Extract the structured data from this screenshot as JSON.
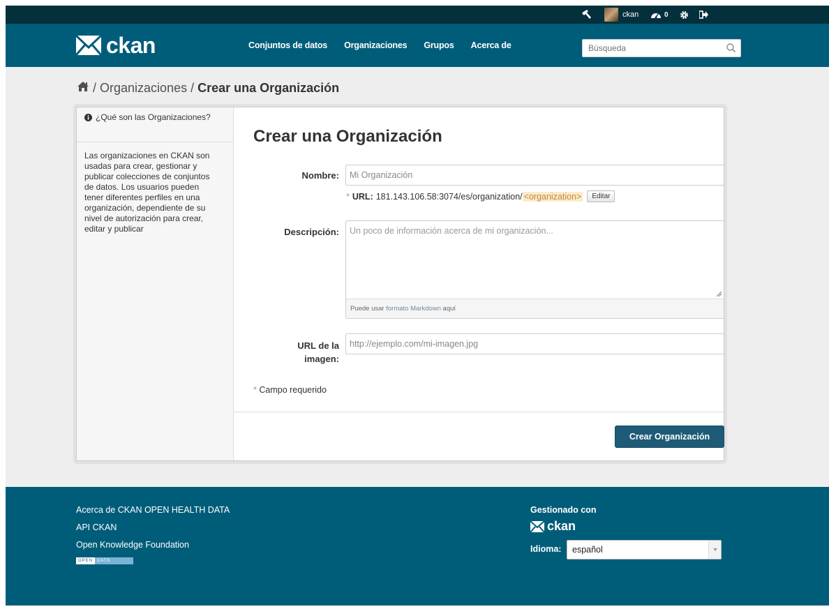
{
  "account": {
    "username": "ckan",
    "activity_count": "0"
  },
  "brand": {
    "logo_text": "ckan"
  },
  "nav": [
    {
      "label": "Conjuntos de datos"
    },
    {
      "label": "Organizaciones"
    },
    {
      "label": "Grupos"
    },
    {
      "label": "Acerca de"
    }
  ],
  "search": {
    "placeholder": "Búsqueda"
  },
  "breadcrumb": {
    "separator": "/",
    "items": [
      {
        "label": "Organizaciones"
      },
      {
        "label": "Crear una Organización"
      }
    ]
  },
  "sidebar": {
    "title": "¿Qué son las Organizaciones?",
    "body": "Las organizaciones en CKAN son usadas para crear, gestionar y publicar colecciones de conjuntos de datos. Los usuarios pueden tener diferentes perfiles en una organización, dependiente de su nivel de autorización para crear, editar y publicar"
  },
  "form": {
    "title": "Crear una Organización",
    "name_label": "Nombre:",
    "name_placeholder": "Mi Organización",
    "required_mark": "*",
    "url_label": "URL:",
    "url_prefix": "181.143.106.58:3074/es/organization/",
    "url_slug": "<organization>",
    "edit_label": "Editar",
    "description_label": "Descripción:",
    "description_placeholder": "Un poco de información acerca de mi organización...",
    "markdown_help_prefix": "Puede usar",
    "markdown_help_link": "formato Markdown",
    "markdown_help_suffix": "aquí",
    "image_label_line1": "URL de la",
    "image_label_line2": "imagen:",
    "image_placeholder": "http://ejemplo.com/mi-imagen.jpg",
    "required_note": "Campo requerido",
    "submit_label": "Crear Organización"
  },
  "footer": {
    "links": [
      {
        "label": "Acerca de CKAN OPEN HEALTH DATA"
      },
      {
        "label": "API CKAN"
      },
      {
        "label": "Open Knowledge Foundation"
      }
    ],
    "open_data_badge": [
      "OPEN",
      "DATA"
    ],
    "managed_by": "Gestionado con",
    "footer_logo_text": "ckan",
    "language_label": "Idioma:",
    "language_value": "español"
  },
  "colors": {
    "masthead": "#005d7a",
    "account_bar": "#04303c",
    "submit_button": "#1d5b76",
    "required_mark": "#c6898b"
  }
}
